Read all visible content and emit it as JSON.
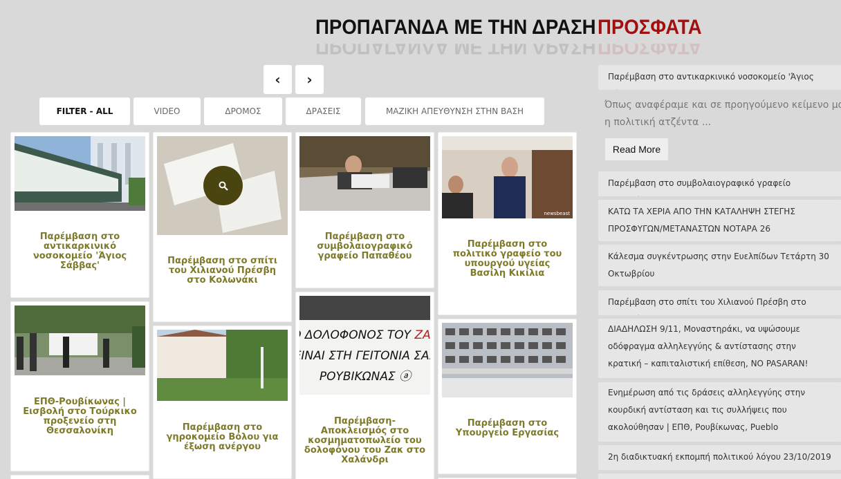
{
  "header": {
    "main_title": "ΠΡΟΠΑΓΑΝΔΑ ΜΕ ΤΗΝ ΔΡΑΣΗ",
    "recent_title": "ΠΡΟΣΦΑΤΑ"
  },
  "pager": {
    "prev": "‹",
    "next": "›"
  },
  "filters": [
    "FILTER - ALL",
    "VIDEO",
    "ΔΡΟΜΟΣ",
    "ΔΡΑΣΕΙΣ",
    "ΜΑΖΙΚΗ ΑΠΕΥΘΥΝΣΗ ΣΤΗΝ ΒΑΣΗ"
  ],
  "cards": [
    "Παρέμβαση στο αντικαρκινικό νοσοκομείο 'Άγιος Σάββας'",
    "Παρέμβαση στο σπίτι του Χιλιανού Πρέσβη στο Κολωνάκι",
    "Παρέμβαση στο συμβολαιογραφικό γραφείο Παπαθέου",
    "Παρέμβαση στο πολιτικό γραφείο του υπουργού υγείας Βασίλη Κικίλια",
    "ΕΠΘ-Ρουβίκωνας | Εισβολή στο Τούρκικο προξενείο στη Θεσσαλονίκη",
    "Παρέμβαση στο γηροκομείο Βόλου για έξωση ανέργου",
    "Παρέμβαση-Αποκλεισμός στο κοσμηματοπωλείο του δολοφόνου του Ζακ στο Χαλάνδρι",
    "Παρέμβαση στο Υπουργείο Εργασίας"
  ],
  "image_texts": {
    "banner": "Ο ΔΟΛΟΦΟΝΟΣ ΤΟΥ ΖΑΚ ΕΙΝΑΙ ΣΤΗ ΓΕΙΤΟΝΙΑ ΣΑΣ ΡΟΥΒΙΚΩΝΑΣ",
    "watermark": "newsbeast"
  },
  "sidebar": {
    "first": "Παρέμβαση στο αντικαρκινικό νοσοκομείο 'Άγιος Σάββας'",
    "excerpt_line1": "Όπως αναφέραμε και σε προηγούμενο κείμενο μας",
    "excerpt_line2": "η πολιτική ατζέντα ...",
    "read_more": "Read More",
    "items": [
      "Παρέμβαση στο συμβολαιογραφικό γραφείο Παπαθέου",
      "ΚΑΤΩ ΤΑ ΧΕΡΙΑ ΑΠΟ ΤΗΝ ΚΑΤΑΛΗΨΗ ΣΤΕΓΗΣ ΠΡΟΣΦΥΓΩΝ/ΜΕΤΑΝΑΣΤΩΝ ΝΟΤΑΡΑ 26",
      "Κάλεσμα συγκέντρωσης στην Ευελπίδων Τετάρτη 30 Οκτωβρίου",
      "Παρέμβαση στο σπίτι του Χιλιανού Πρέσβη στο Κολωνάκι",
      "ΔΙΑΔΗΛΩΣΗ 9/11, Μοναστηράκι, να υψώσουμε οδόφραγμα αλληλεγγύης & αντίστασης στην κρατική – καπιταλιστική επίθεση, NO PASARAN!",
      "Ενημέρωση από τις δράσεις αλληλεγγύης στην κουρδική αντίσταση και τις συλλήψεις που ακολούθησαν | ΕΠΘ, Ρουβίκωνας, Pueblo",
      "2η διαδικτυακή εκπομπή πολιτικού λόγου 23/10/2019"
    ]
  }
}
